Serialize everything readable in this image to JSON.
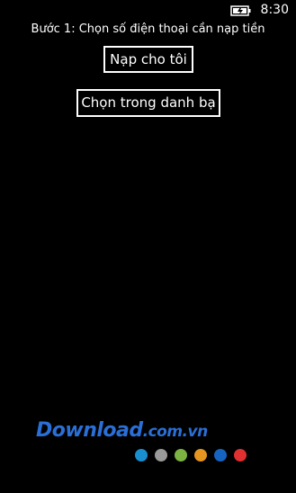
{
  "status_bar": {
    "time": "8:30",
    "battery_icon": "battery-charging-icon"
  },
  "main": {
    "instruction": "Bước 1: Chọn số điện thoại cần nạp tiền",
    "topup_self_label": "Nạp cho tôi",
    "choose_contacts_label": "Chọn trong danh bạ"
  },
  "watermark": {
    "logo_main": "Download",
    "logo_domain": ".com.vn",
    "dot_colors": [
      "#1a8fd0",
      "#9a9a9a",
      "#7cb342",
      "#e6961e",
      "#1565c0",
      "#e03030"
    ]
  },
  "colors": {
    "background": "#000000",
    "foreground": "#ffffff",
    "brand_blue": "#2a6fd6"
  }
}
